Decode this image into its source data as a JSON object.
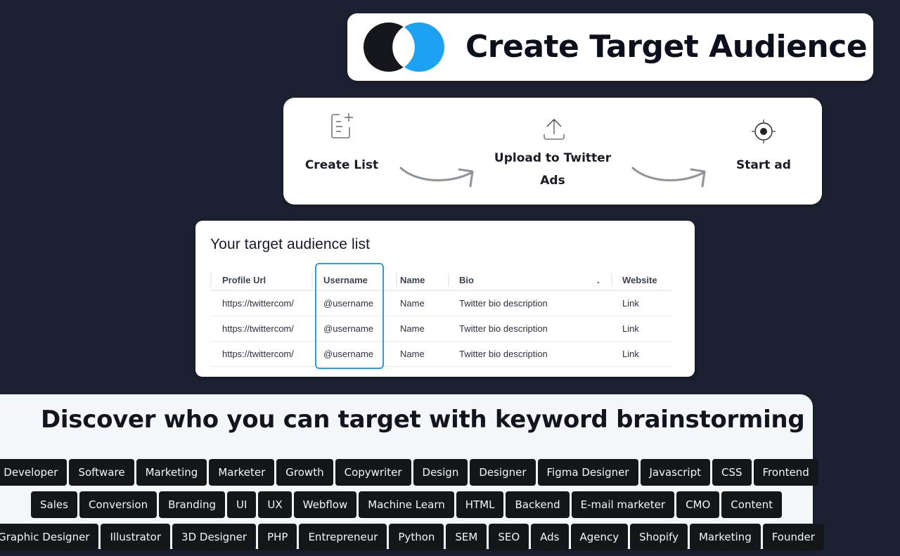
{
  "header": {
    "title": "Create Target Audience",
    "logo": {
      "left_color": "#14171c",
      "right_color": "#1da1f2"
    }
  },
  "steps": [
    {
      "label_line1": "Create List",
      "label_line2": "",
      "icon": "list-add-icon"
    },
    {
      "label_line1": "Upload to Twitter",
      "label_line2": "Ads",
      "icon": "upload-icon"
    },
    {
      "label_line1": "Start ad",
      "label_line2": "",
      "icon": "target-icon"
    }
  ],
  "audience_table": {
    "title": "Your target audience list",
    "columns": [
      "Profile Url",
      "Username",
      "Name",
      "Bio",
      ".",
      "Website"
    ],
    "rows": [
      [
        "https://twittercom/",
        "@username",
        "Name",
        "Twitter bio description",
        "",
        "Link"
      ],
      [
        "https://twittercom/",
        "@username",
        "Name",
        "Twitter bio description",
        "",
        "Link"
      ],
      [
        "https://twittercom/",
        "@username",
        "Name",
        "Twitter bio description",
        "",
        "Link"
      ]
    ],
    "highlight_color": "#2c9ee6"
  },
  "keywords": {
    "title": "Discover who you can target with keyword brainstorming",
    "rows": [
      [
        "Developer",
        "Software",
        "Marketing",
        "Marketer",
        "Growth",
        "Copywriter",
        "Design",
        "Designer",
        "Figma Designer",
        "Javascript",
        "CSS",
        "Frontend"
      ],
      [
        "Sales",
        "Conversion",
        "Branding",
        "UI",
        "UX",
        "Webflow",
        "Machine Learn",
        "HTML",
        "Backend",
        "E-mail marketer",
        "CMO",
        "Content"
      ],
      [
        "Graphic Designer",
        "Illustrator",
        "3D Designer",
        "PHP",
        "Entrepreneur",
        "Python",
        "SEM",
        "SEO",
        "Ads",
        "Agency",
        "Shopify",
        "Marketing",
        "Founder"
      ]
    ]
  }
}
